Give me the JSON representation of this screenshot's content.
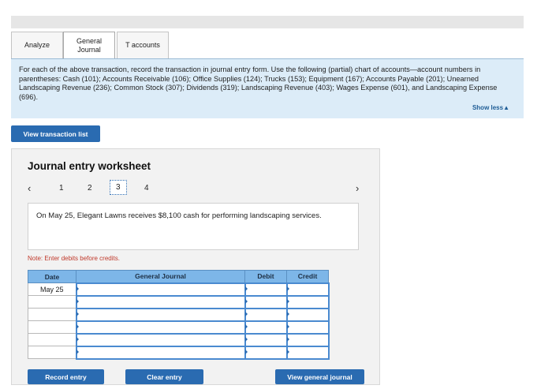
{
  "tabs": [
    {
      "label": "Analyze"
    },
    {
      "label": "General\nJournal"
    },
    {
      "label": "T accounts"
    }
  ],
  "instructions": {
    "text": "For each of the above transaction, record the transaction in journal entry form. Use the following (partial) chart of accounts—account numbers in parentheses: Cash (101); Accounts Receivable (106); Office Supplies (124); Trucks (153); Equipment (167); Accounts Payable (201); Unearned Landscaping Revenue (236); Common Stock (307); Dividends (319); Landscaping Revenue (403); Wages Expense (601), and Landscaping Expense (696).",
    "show_less": "Show less▲"
  },
  "view_transaction_list": "View transaction list",
  "worksheet": {
    "title": "Journal entry worksheet",
    "prev": "‹",
    "next": "›",
    "pages": [
      "1",
      "2",
      "3",
      "4"
    ],
    "current_page": "3",
    "description": "On May 25, Elegant Lawns receives $8,100 cash for performing landscaping services.",
    "note": "Note: Enter debits before credits.",
    "headers": {
      "date": "Date",
      "general_journal": "General Journal",
      "debit": "Debit",
      "credit": "Credit"
    },
    "rows": [
      {
        "date": "May 25",
        "account": "",
        "debit": "",
        "credit": ""
      },
      {
        "date": "",
        "account": "",
        "debit": "",
        "credit": ""
      },
      {
        "date": "",
        "account": "",
        "debit": "",
        "credit": ""
      },
      {
        "date": "",
        "account": "",
        "debit": "",
        "credit": ""
      },
      {
        "date": "",
        "account": "",
        "debit": "",
        "credit": ""
      },
      {
        "date": "",
        "account": "",
        "debit": "",
        "credit": ""
      }
    ],
    "buttons": {
      "record": "Record entry",
      "clear": "Clear entry",
      "view_general_journal": "View general journal"
    }
  },
  "colors": {
    "accent": "#2a6bb1",
    "instructions_bg": "#dcecf8",
    "table_header": "#7db6e8",
    "note": "#c0392b"
  }
}
